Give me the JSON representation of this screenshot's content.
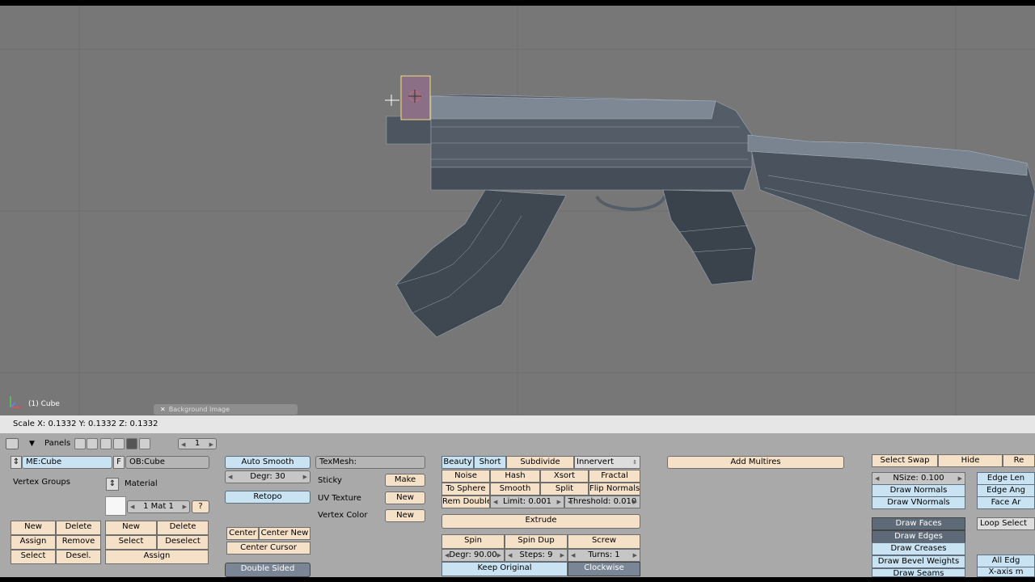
{
  "viewport": {
    "object_label": "(1) Cube",
    "background_tab": "Background Image",
    "axis_icon": "axis-gizmo-icon"
  },
  "status": {
    "scale_text": "Scale X: 0.1332   Y: 0.1332   Z: 0.1332"
  },
  "panel_header": {
    "panels_label": "Panels",
    "frame_value": "1"
  },
  "link_materials": {
    "me_field": "ME:Cube",
    "f_label": "F",
    "ob_field": "OB:Cube",
    "vertex_groups": "Vertex Groups",
    "material": "Material",
    "mat_value": "1 Mat 1",
    "question": "?",
    "vg_new": "New",
    "vg_delete": "Delete",
    "vg_assign": "Assign",
    "vg_remove": "Remove",
    "vg_select": "Select",
    "vg_desel": "Desel.",
    "mat_new": "New",
    "mat_delete": "Delete",
    "mat_select": "Select",
    "mat_deselect": "Deselect",
    "mat_assign": "Assign"
  },
  "mesh": {
    "auto_smooth": "Auto Smooth",
    "degr": "Degr: 30",
    "retopo": "Retopo",
    "center": "Center",
    "center_new": "Center New",
    "center_cursor": "Center Cursor",
    "double_sided": "Double Sided",
    "texmesh": "TexMesh:",
    "sticky": "Sticky",
    "make": "Make",
    "uv_texture": "UV Texture",
    "uv_new": "New",
    "vertex_color": "Vertex Color",
    "vc_new": "New"
  },
  "mesh_tools": {
    "beauty": "Beauty",
    "short": "Short",
    "subdivide": "Subdivide",
    "innervert": "Innervert",
    "noise": "Noise",
    "hash": "Hash",
    "xsort": "Xsort",
    "fractal": "Fractal",
    "to_sphere": "To Sphere",
    "smooth": "Smooth",
    "split": "Split",
    "flip_normals": "Flip Normals",
    "rem_double": "Rem Double",
    "limit": "Limit: 0.001",
    "threshold": "Threshold: 0.010",
    "extrude": "Extrude",
    "spin": "Spin",
    "spin_dup": "Spin Dup",
    "screw": "Screw",
    "degr": "Degr: 90.00",
    "steps": "Steps: 9",
    "turns": "Turns: 1",
    "keep_original": "Keep Original",
    "clockwise": "Clockwise"
  },
  "multires": {
    "add_multires": "Add Multires"
  },
  "mesh_tools_more": {
    "select_swap": "Select Swap",
    "hide": "Hide",
    "reveal_partial": "Re",
    "nsize": "NSize: 0.100",
    "draw_normals": "Draw Normals",
    "draw_vnormals": "Draw VNormals",
    "draw_faces": "Draw Faces",
    "draw_edges": "Draw Edges",
    "draw_creases": "Draw Creases",
    "draw_bevel_weights": "Draw Bevel Weights",
    "draw_seams": "Draw Seams",
    "edge_length_partial": "Edge Len",
    "edge_angles_partial": "Edge Ang",
    "face_area_partial": "Face Ar",
    "loop_select": "Loop Select",
    "all_edges_partial": "All Edg",
    "x_axis_partial": "X-axis m"
  }
}
